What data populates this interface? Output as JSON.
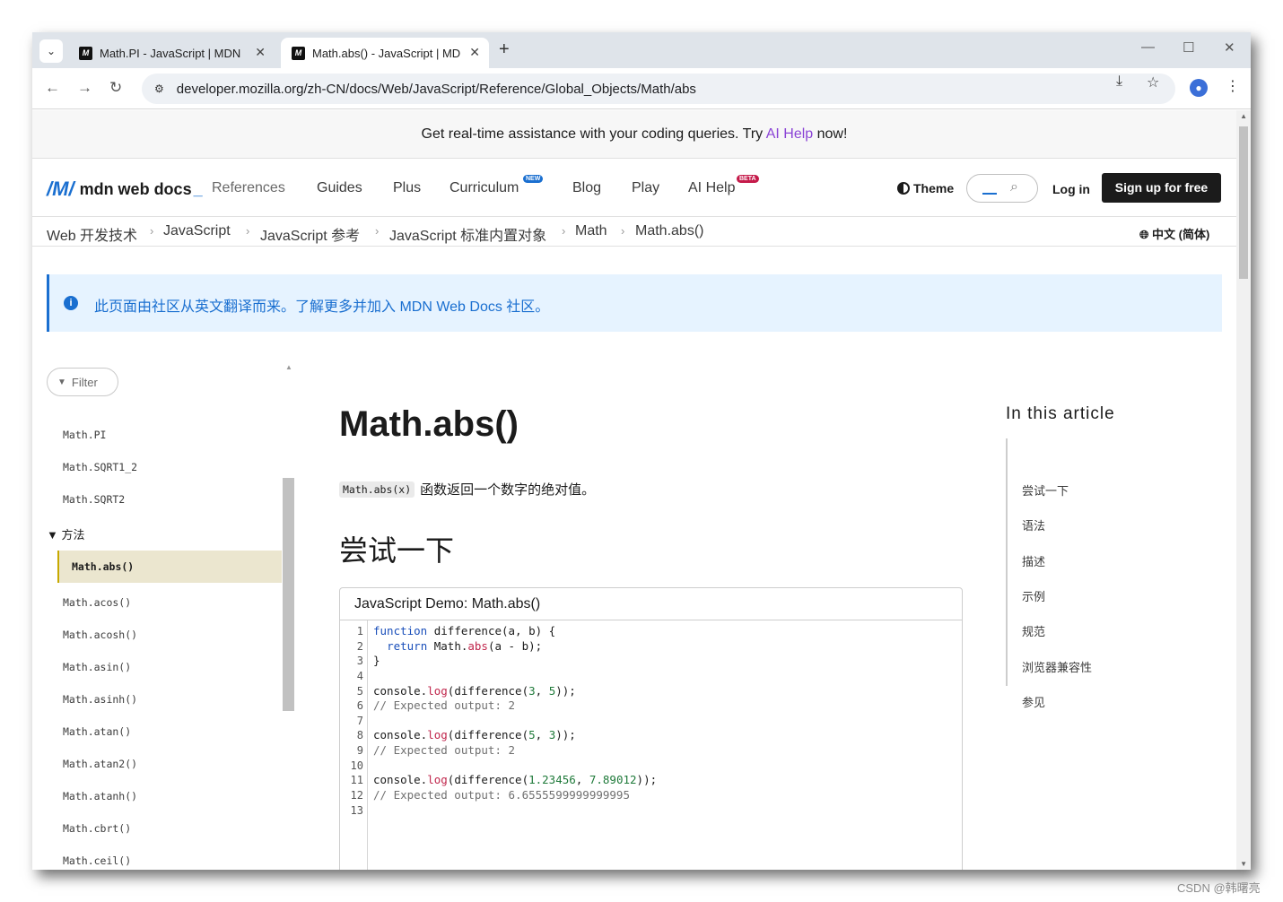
{
  "browser": {
    "tabs": [
      {
        "label": "Math.PI - JavaScript | MDN",
        "active": false
      },
      {
        "label": "Math.abs() - JavaScript | MDN",
        "active": true
      }
    ],
    "favicon_text": "M",
    "new_tab": "+",
    "url": "developer.mozilla.org/zh-CN/docs/Web/JavaScript/Reference/Global_Objects/Math/abs",
    "window_controls": [
      "minimize-icon",
      "maximize-icon",
      "close-icon"
    ]
  },
  "banner": {
    "prefix": "Get real-time assistance with your coding queries. Try ",
    "link": "AI Help",
    "suffix": " now!"
  },
  "header": {
    "logo": "mdn web docs",
    "logo_underscore": "_",
    "nav": [
      {
        "label": "References"
      },
      {
        "label": "Guides"
      },
      {
        "label": "Plus"
      },
      {
        "label": "Curriculum",
        "badge": "NEW"
      },
      {
        "label": "Blog"
      },
      {
        "label": "Play"
      },
      {
        "label": "AI Help",
        "badge": "BETA"
      }
    ],
    "theme": "Theme",
    "login": "Log in",
    "signup": "Sign up for free"
  },
  "breadcrumbs": [
    "Web 开发技术",
    "JavaScript",
    "JavaScript 参考",
    "JavaScript 标准内置对象",
    "Math",
    "Math.abs()"
  ],
  "language": "中文 (简体)",
  "notice": "此页面由社区从英文翻译而来。了解更多并加入 MDN Web Docs 社区。",
  "sidebar": {
    "filter_placeholder": "Filter",
    "items_before": [
      "Math.PI",
      "Math.SQRT1_2",
      "Math.SQRT2"
    ],
    "group": "▼ 方法",
    "active": "Math.abs()",
    "items_after": [
      "Math.acos()",
      "Math.acosh()",
      "Math.asin()",
      "Math.asinh()",
      "Math.atan()",
      "Math.atan2()",
      "Math.atanh()",
      "Math.cbrt()",
      "Math.ceil()"
    ]
  },
  "main": {
    "title": "Math.abs()",
    "intro_code": "Math.abs(x)",
    "intro_text": "函数返回一个数字的绝对值。",
    "section": "尝试一下",
    "demo_title": "JavaScript Demo: Math.abs()",
    "line_numbers": [
      "1",
      "2",
      "3",
      "4",
      "5",
      "6",
      "7",
      "8",
      "9",
      "10",
      "11",
      "12",
      "13"
    ]
  },
  "toc": {
    "title": "In this article",
    "items": [
      "尝试一下",
      "语法",
      "描述",
      "示例",
      "规范",
      "浏览器兼容性",
      "参见"
    ]
  },
  "watermark": "CSDN @韩曙亮"
}
